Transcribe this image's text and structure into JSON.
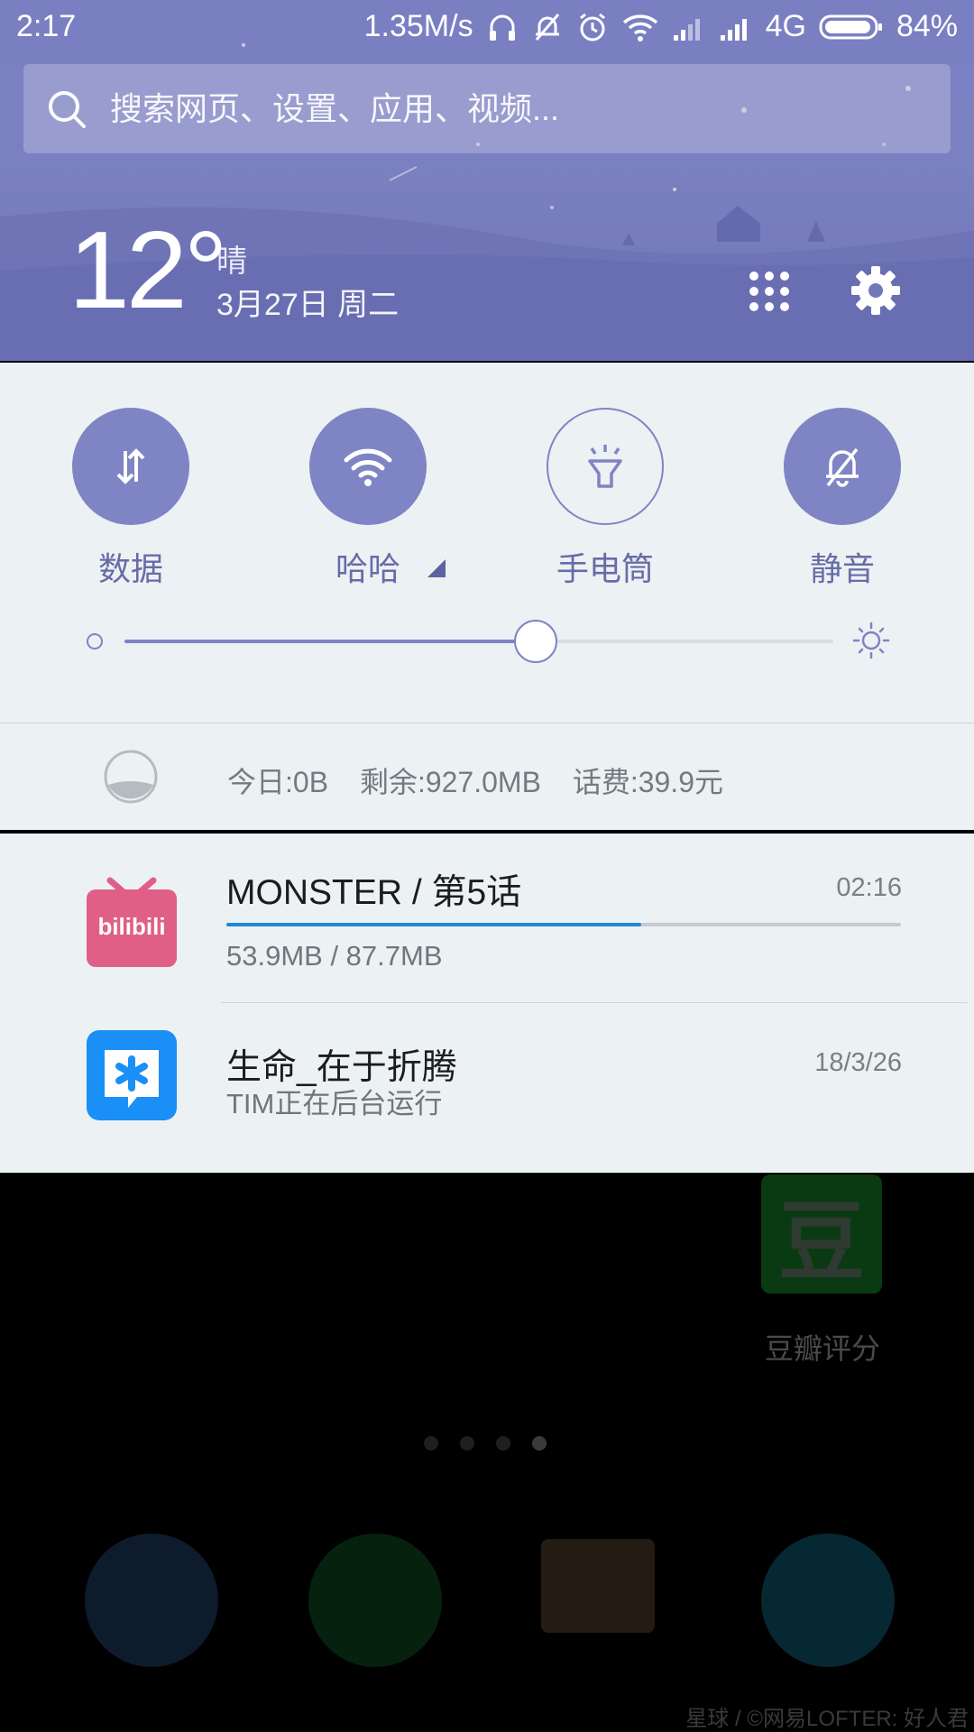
{
  "status_bar": {
    "time": "2:17",
    "speed": "1.35M/s",
    "network": "4G",
    "battery": "84%"
  },
  "search": {
    "placeholder": "搜索网页、设置、应用、视频..."
  },
  "weather": {
    "temperature": "12°",
    "condition": "晴",
    "date": "3月27日 周二"
  },
  "toggles": [
    {
      "label": "数据",
      "icon": "data-arrows-icon",
      "on": true
    },
    {
      "label": "哈哈",
      "icon": "wifi-icon",
      "on": true
    },
    {
      "label": "手电筒",
      "icon": "flashlight-icon",
      "on": false
    },
    {
      "label": "静音",
      "icon": "bell-mute-icon",
      "on": true
    }
  ],
  "brightness": {
    "level": 0.58
  },
  "data_usage": {
    "today": "今日:0B",
    "remaining": "剩余:927.0MB",
    "balance": "话费:39.9元"
  },
  "notifications": [
    {
      "app": "bilibili",
      "icon_text": "bilibili",
      "title": "MONSTER / 第5话",
      "time": "02:16",
      "progress": 0.615,
      "subtitle": "53.9MB / 87.7MB"
    },
    {
      "app": "TIM",
      "title": "生命_在于折腾",
      "time": "18/3/26",
      "subtitle": "TIM正在后台运行"
    }
  ],
  "home": {
    "douban_glyph": "豆",
    "douban_label": "豆瓣评分",
    "watermark": "星球 / ©网易LOFTER: 好人君"
  },
  "colors": {
    "accent": "#7e84c4",
    "header": "#7a7fc2",
    "panel": "#ecf1f3",
    "progress": "#1e88d8"
  }
}
